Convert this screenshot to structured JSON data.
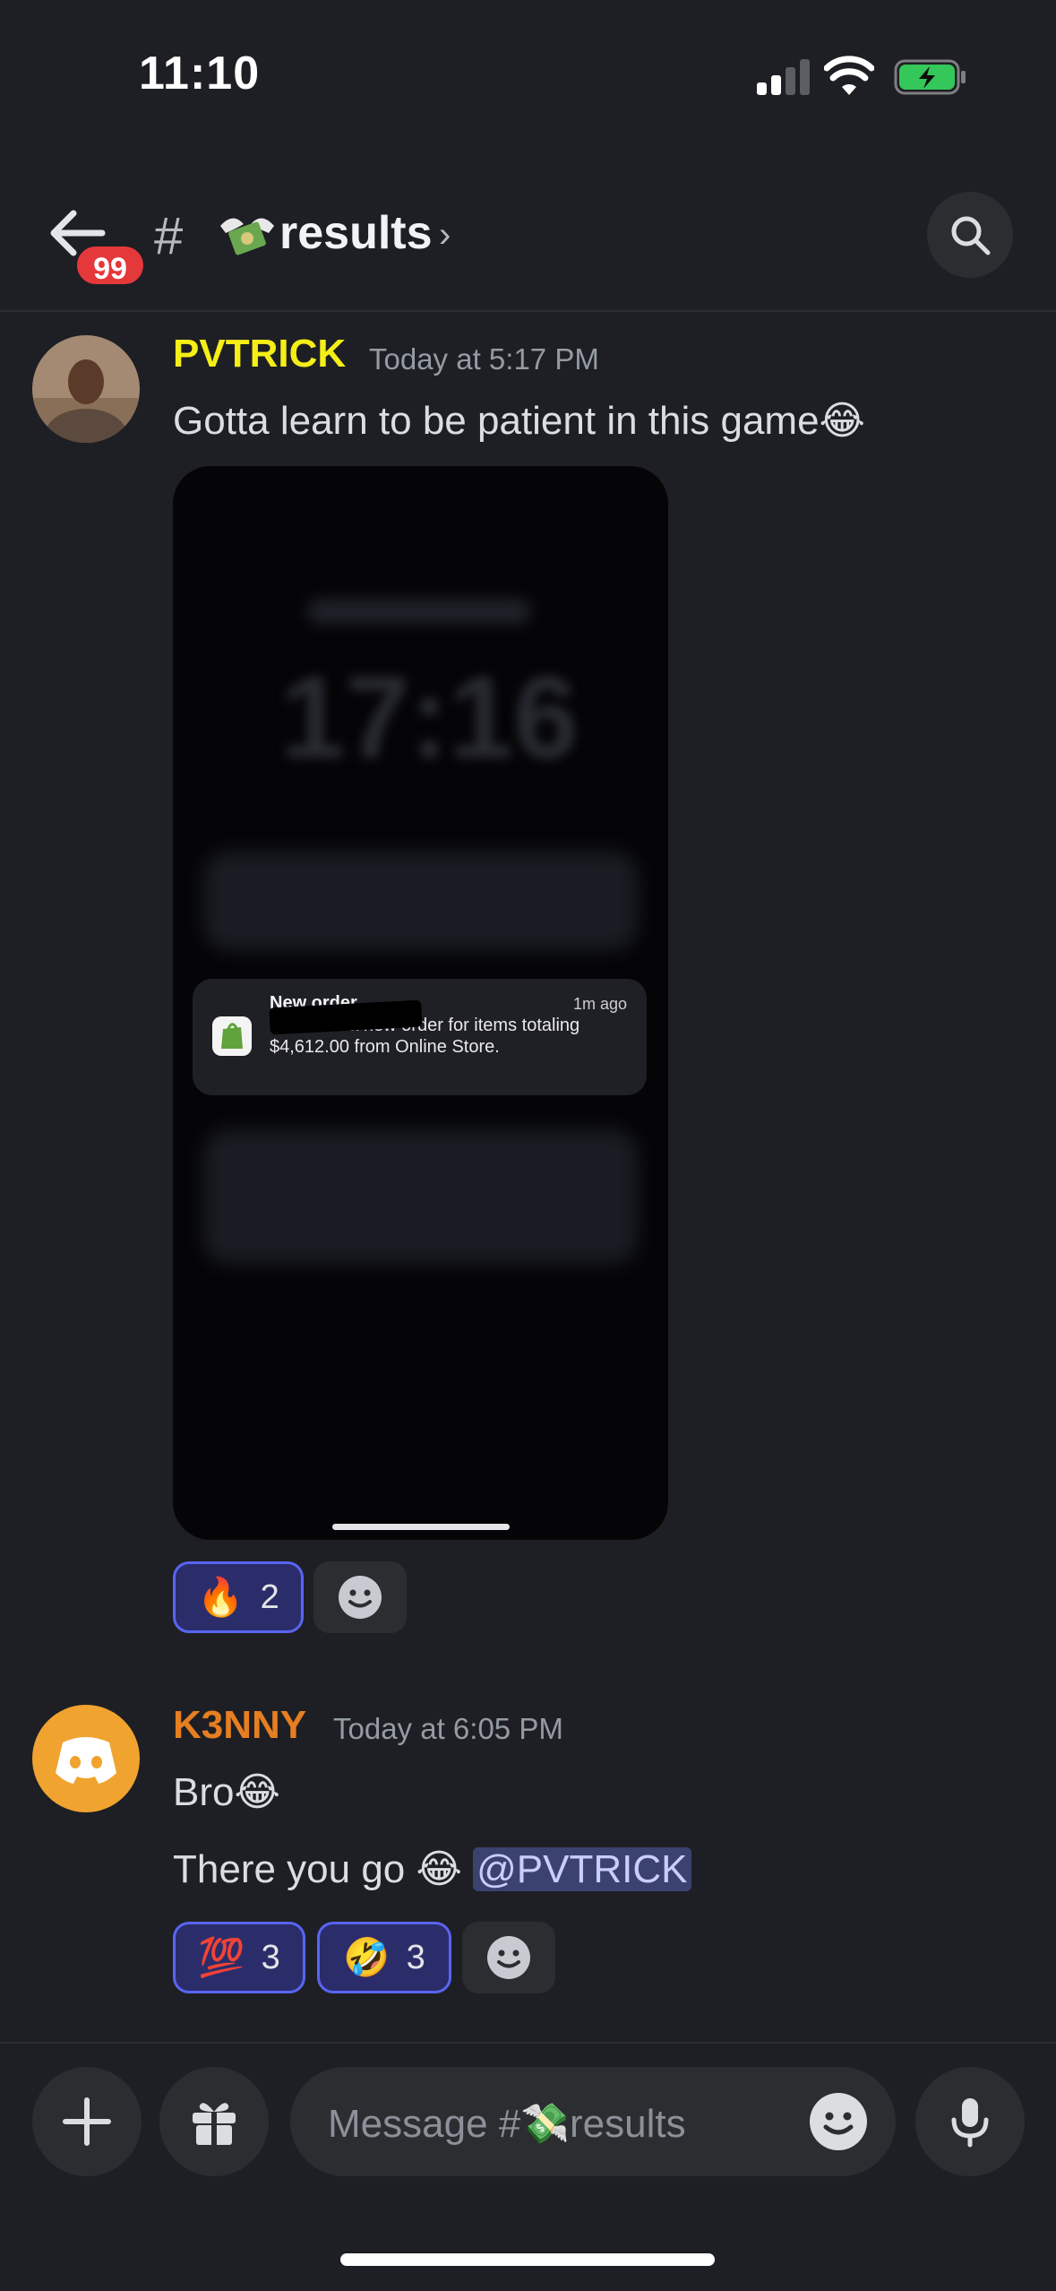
{
  "status_bar": {
    "time": "11:10"
  },
  "header": {
    "unread_badge": "99",
    "channel_prefix": "#",
    "channel_name": "results",
    "chevron": "›"
  },
  "messages": [
    {
      "username": "PVTRICK",
      "username_color": "#f5ee17",
      "timestamp": "Today at 5:17 PM",
      "lines": [
        "Gotta learn to be patient in this game😂"
      ],
      "attachment": {
        "clock": "17:16",
        "notification": {
          "title": "New order",
          "ago": "1m ago",
          "body": "You have a new order for items totaling $4,612.00 from Online Store."
        }
      },
      "reactions": [
        {
          "emoji": "🔥",
          "count": "2"
        }
      ]
    },
    {
      "username": "K3NNY",
      "username_color": "#e67e22",
      "timestamp": "Today at 6:05 PM",
      "lines": [
        "Bro😂",
        "There you go 😂 "
      ],
      "mention": "@PVTRICK",
      "reactions": [
        {
          "emoji": "💯",
          "count": "3"
        },
        {
          "emoji": "🤣",
          "count": "3"
        }
      ]
    }
  ],
  "composer": {
    "placeholder": "Message #💸results"
  },
  "icons": [
    "back-arrow-icon",
    "search-icon",
    "plus-icon",
    "gift-icon",
    "smiley-icon",
    "microphone-icon",
    "money-with-wings-icon",
    "discord-logo-icon",
    "shopify-icon"
  ]
}
